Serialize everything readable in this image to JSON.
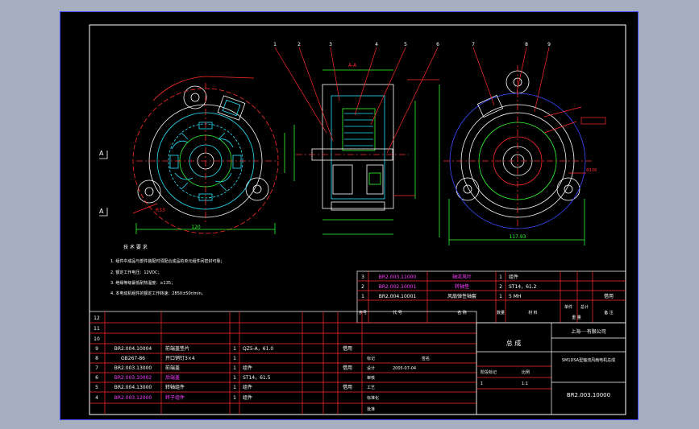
{
  "balloons": [
    "1",
    "2",
    "3",
    "4",
    "5",
    "6",
    "7",
    "8",
    "9"
  ],
  "section_label": "A-A",
  "view_marks": [
    "A",
    "A"
  ],
  "tech_req": {
    "title": "技 术 要 求",
    "items": [
      "1. 组件中成品与部件装配时须配合成品的单元组件间密封可靠；",
      "2. 额定工作电压：12VDC；",
      "3. 绝缘等级最低耐热温度：≥135；",
      "4. 本电动机组件的额定工作转速：2850±50r/min。"
    ]
  },
  "parts_top": [
    {
      "no": "3",
      "code": "BR2.003.11000",
      "name": "轴流风叶",
      "qty": "1",
      "material": "组件",
      "note": "",
      "highlight": true
    },
    {
      "no": "2",
      "code": "BR2.002.10001",
      "name": "转轴垫",
      "qty": "2",
      "material": "ST14，61.2",
      "note": "",
      "highlight": true
    },
    {
      "no": "1",
      "code": "BR2.004.10001",
      "name": "风扇弹性轴套",
      "qty": "1",
      "material": "5 MH",
      "note": "借用",
      "highlight": false
    }
  ],
  "parts_top_header": {
    "no": "序号",
    "code": "代 号",
    "name": "名 称",
    "qty": "数量",
    "material": "材 料",
    "unit_w": "单件",
    "total_w": "总计",
    "weight": "重 量",
    "note": "备 注"
  },
  "parts_left_empty": [
    "12",
    "11",
    "10"
  ],
  "parts_left": [
    {
      "no": "9",
      "code": "BR2.004.10004",
      "name": "前端盖垫片",
      "qty": "1",
      "material": "QZ5-A，61.0",
      "note": "借用",
      "highlight": false
    },
    {
      "no": "8",
      "code": "GB267-86",
      "name": "开口销钉3×4",
      "qty": "1",
      "material": "",
      "note": "",
      "highlight": false
    },
    {
      "no": "7",
      "code": "BR2.003.13000",
      "name": "前端盖",
      "qty": "1",
      "material": "组件",
      "note": "借用",
      "highlight": false
    },
    {
      "no": "6",
      "code": "BR2.003.10002",
      "name": "后端盖",
      "qty": "1",
      "material": "ST14，61.5",
      "note": "",
      "highlight": true
    },
    {
      "no": "5",
      "code": "BR2.004.13000",
      "name": "转轴组件",
      "qty": "1",
      "material": "组件",
      "note": "借用",
      "highlight": false
    },
    {
      "no": "4",
      "code": "BR2.003.12000",
      "name": "转子组件",
      "qty": "1",
      "material": "组件",
      "note": "",
      "highlight": true
    }
  ],
  "title_block": {
    "drawing_name": "总 成",
    "company": "上海····有限公司",
    "product": "SM1DSA型轴流风扇电机总成",
    "drawing_no": "BR2.003.10000",
    "date": "2005-07-04",
    "scale_label": "比例",
    "scale": "1:1",
    "sheet": "1",
    "rows": [
      "标记",
      "设计",
      "审核",
      "工艺",
      "标准化",
      "批准"
    ],
    "sign": "签名",
    "stage_label": "阶段标记"
  },
  "dims": {
    "front_w": "120",
    "rear_w": "117.93",
    "left_r": "R33",
    "rear_d": "Φ106"
  },
  "colors": {
    "line": "#ffffff",
    "red": "#ff2b2b",
    "cyan": "#27e6ff",
    "green": "#33ff33",
    "yellow": "#ffff33",
    "magenta": "#ff3dff",
    "blue": "#3b4cff"
  }
}
